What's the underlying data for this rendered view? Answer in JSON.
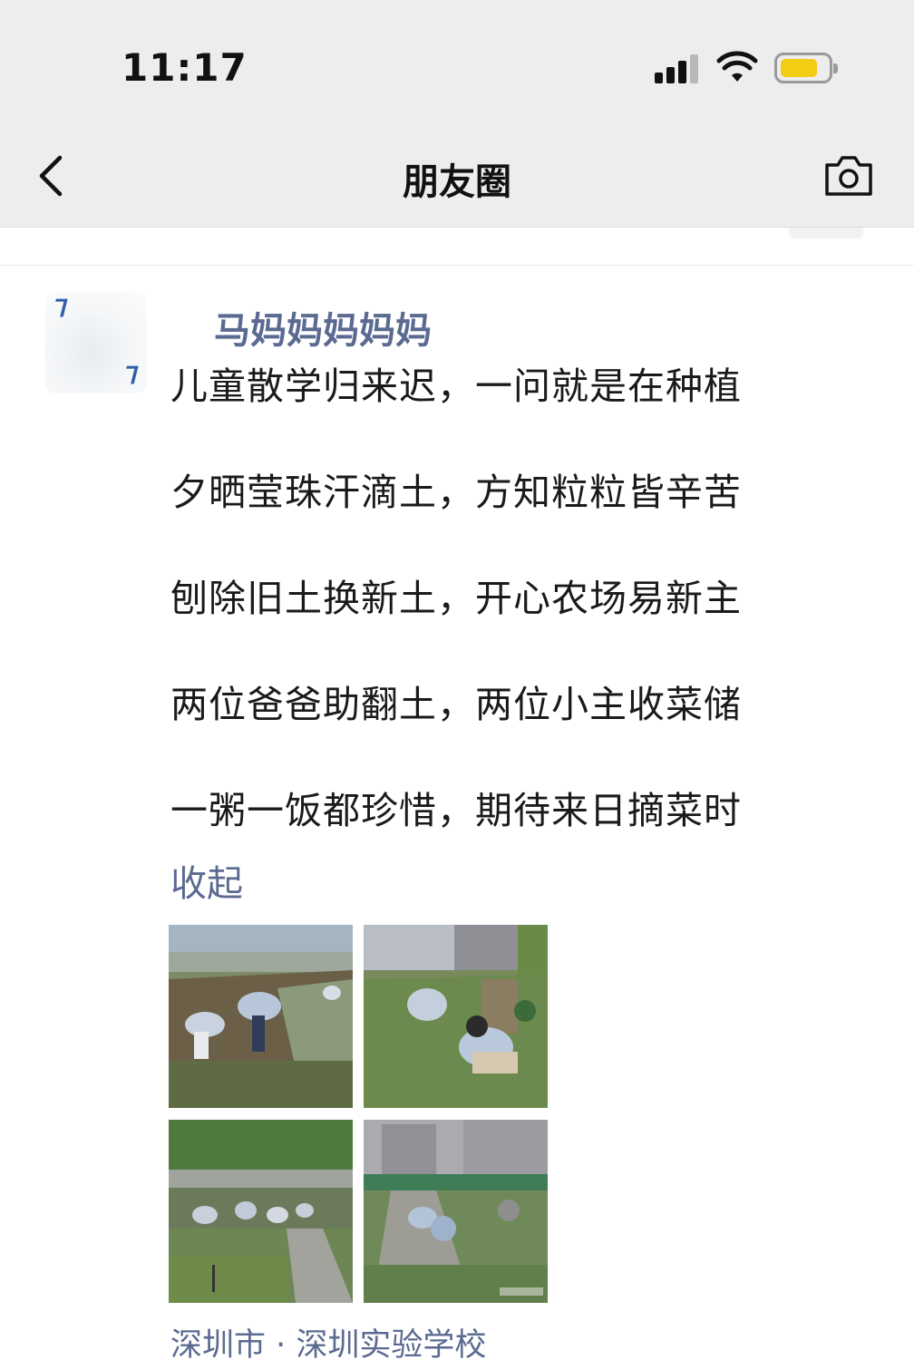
{
  "status_bar": {
    "time": "11:17",
    "signal_icon": "cellular-signal-icon",
    "wifi_icon": "wifi-icon",
    "battery_icon": "battery-icon",
    "battery_color": "#f5cc14"
  },
  "nav": {
    "back_icon": "chevron-left-icon",
    "title": "朋友圈",
    "camera_icon": "camera-icon"
  },
  "post": {
    "username": "马妈妈妈妈妈",
    "poem_lines": [
      "儿童散学归来迟，一问就是在种植",
      "夕晒莹珠汗滴土，方知粒粒皆辛苦",
      "刨除旧土换新土，开心农场易新主",
      "两位爸爸助翻土，两位小主收菜储",
      "一粥一饭都珍惜，期待来日摘菜时"
    ],
    "collapse_label": "收起",
    "photo_count": 4,
    "location": "深圳市 · 深圳实验学校"
  },
  "colors": {
    "link": "#5b6a91",
    "nav_bg": "#ededed",
    "text": "#1a1a1a"
  }
}
